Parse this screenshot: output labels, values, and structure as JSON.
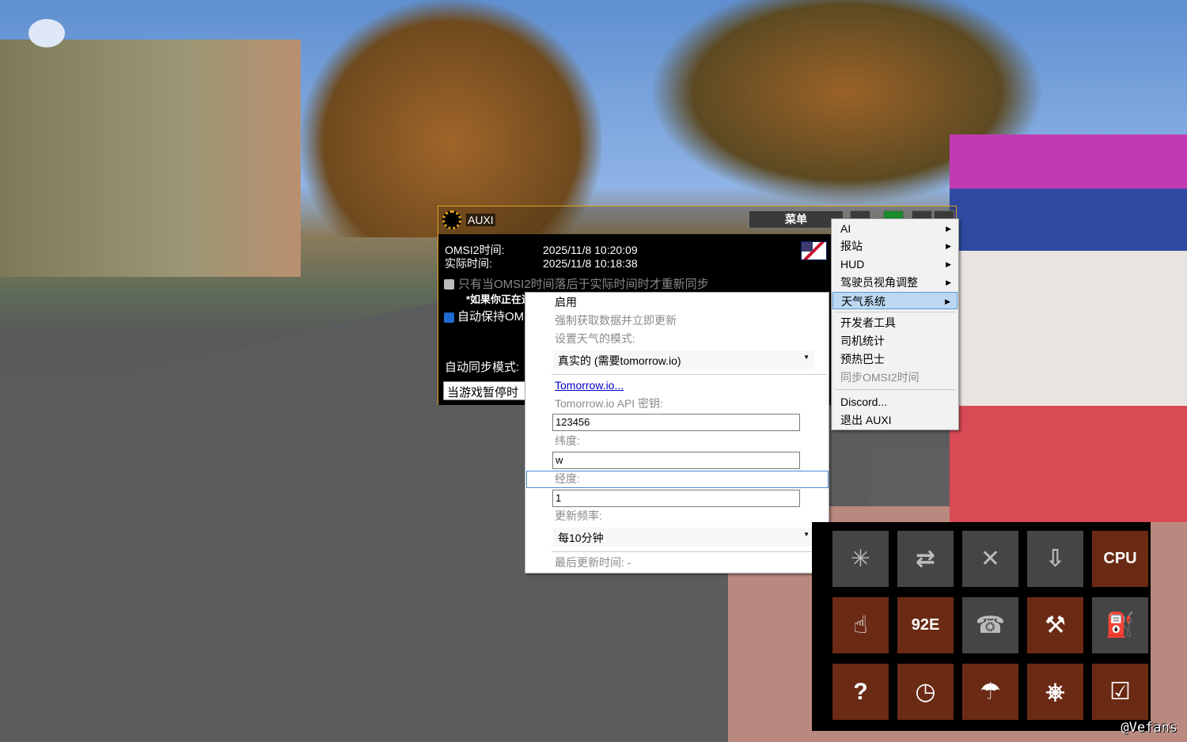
{
  "window": {
    "title": "AUXI",
    "menu_button": "菜单"
  },
  "time": {
    "omsi_label": "OMSI2时间:",
    "omsi_value": "2025/11/8 10:20:09",
    "real_label": "实际时间:",
    "real_value": "2025/11/8 10:18:38"
  },
  "options": {
    "only_when_behind": "只有当OMSI2时间落后于实际时间时才重新同步",
    "note": "*如果你正在运",
    "auto_keep": "自动保持OMS",
    "only_when_behind_checked": true,
    "auto_keep_checked": true
  },
  "sync_mode": {
    "label": "自动同步模式:",
    "value": "当游戏暂停时"
  },
  "menu": {
    "items": [
      {
        "label": "AI",
        "submenu": true
      },
      {
        "label": "报站",
        "submenu": true
      },
      {
        "label": "HUD",
        "submenu": true
      },
      {
        "label": "驾驶员视角调整",
        "submenu": true
      },
      {
        "label": "天气系统",
        "submenu": true,
        "highlighted": true
      },
      {
        "label": "开发者工具"
      },
      {
        "label": "司机统计"
      },
      {
        "label": "预热巴士"
      },
      {
        "label": "同步OMSI2时间",
        "disabled": true
      },
      {
        "label": "Discord..."
      },
      {
        "label": "退出 AUXI"
      }
    ]
  },
  "weather": {
    "enable": "启用",
    "force_fetch": "强制获取数据并立即更新",
    "mode_label": "设置天气的模式:",
    "mode_value": "真实的 (需要tomorrow.io)",
    "link": "Tomorrow.io...",
    "api_key_label": "Tomorrow.io API 密钥:",
    "api_key_value": "123456",
    "lat_label": "纬度:",
    "lat_value": "w",
    "lon_label": "经度:",
    "lon_value": "1",
    "freq_label": "更新频率:",
    "freq_value": "每10分钟",
    "last_update": "最后更新时间: -"
  },
  "tiles": [
    {
      "icon": "bus-snow-icon",
      "glyph": "✳",
      "active": false
    },
    {
      "icon": "bus-swap-icon",
      "glyph": "⇄",
      "active": false
    },
    {
      "icon": "bus-remove-icon",
      "glyph": "✕",
      "active": false
    },
    {
      "icon": "bus-despawn-icon",
      "glyph": "⇩",
      "active": false
    },
    {
      "icon": "bus-cpu-icon",
      "glyph": "CPU",
      "active": true
    },
    {
      "icon": "timetable-icon",
      "glyph": "☝",
      "active": true
    },
    {
      "icon": "destination-sign-icon",
      "glyph": "92E",
      "active": true
    },
    {
      "icon": "police-call-icon",
      "glyph": "☎",
      "active": false
    },
    {
      "icon": "tools-icon",
      "glyph": "⚒",
      "active": true
    },
    {
      "icon": "fuel-icon",
      "glyph": "⛽",
      "active": false
    },
    {
      "icon": "help-arrow-icon",
      "glyph": "?",
      "active": true
    },
    {
      "icon": "clock-icon",
      "glyph": "◷",
      "active": true
    },
    {
      "icon": "weather-icon",
      "glyph": "☂",
      "active": true
    },
    {
      "icon": "controls-icon",
      "glyph": "⎈",
      "active": true
    },
    {
      "icon": "driver-checklist-icon",
      "glyph": "☑",
      "active": true
    }
  ],
  "watermark": "@Vefans",
  "colors": {
    "active_tile": "#6b2a14",
    "inactive_tile": "#454545",
    "accent": "#e0a020"
  }
}
